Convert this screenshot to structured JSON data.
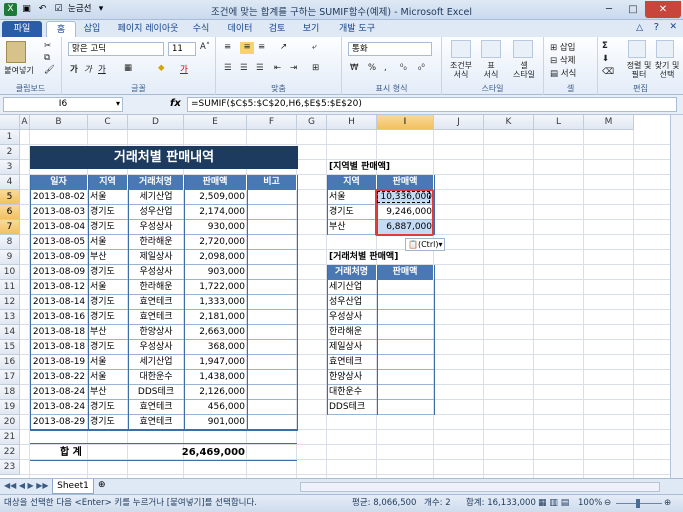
{
  "window": {
    "title": "조건에 맞는 합계를 구하는 SUMIF함수(예제) - Microsoft Excel",
    "qat_label": "눈금선"
  },
  "tabs": [
    "파일",
    "홈",
    "삽입",
    "페이지 레이아웃",
    "수식",
    "데이터",
    "검토",
    "보기",
    "개발 도구"
  ],
  "ribbon": {
    "clipboard": {
      "paste": "붙여넣기",
      "label": "클립보드"
    },
    "font": {
      "name": "맑은 고딕",
      "size": "11",
      "label": "글꼴"
    },
    "align": {
      "label": "맞춤"
    },
    "number": {
      "format": "통화",
      "label": "표시 형식"
    },
    "styles": {
      "cond": "조건부\n서식",
      "table": "표\n서식",
      "cell": "셀\n스타일",
      "label": "스타일"
    },
    "cells": {
      "insert": "삽입",
      "delete": "삭제",
      "format": "서식",
      "label": "셀"
    },
    "editing": {
      "sort": "정렬 및\n필터",
      "find": "찾기 및\n선택",
      "label": "편집"
    }
  },
  "formula_bar": {
    "name_box": "I6",
    "fx": "fx",
    "formula": "=SUMIF($C$5:$C$20,H6,$E$5:$E$20)"
  },
  "columns": [
    "A",
    "B",
    "C",
    "D",
    "E",
    "F",
    "G",
    "H",
    "I",
    "J",
    "K",
    "L",
    "M"
  ],
  "rows": [
    "1",
    "2",
    "3",
    "4",
    "5",
    "6",
    "7",
    "8",
    "9",
    "10",
    "11",
    "12",
    "13",
    "14",
    "15",
    "16",
    "17",
    "18",
    "19",
    "20",
    "21",
    "22",
    "23"
  ],
  "sheet": {
    "title": "거래처별 판매내역",
    "main_headers": [
      "일자",
      "지역",
      "거래처명",
      "판매액",
      "비고"
    ],
    "main_rows": [
      [
        "2013-08-02",
        "서울",
        "세기산업",
        "2,509,000",
        ""
      ],
      [
        "2013-08-03",
        "경기도",
        "성우산업",
        "2,174,000",
        ""
      ],
      [
        "2013-08-04",
        "경기도",
        "우성상사",
        "930,000",
        ""
      ],
      [
        "2013-08-05",
        "서울",
        "한라해운",
        "2,720,000",
        ""
      ],
      [
        "2013-08-09",
        "부산",
        "제일상사",
        "2,098,000",
        ""
      ],
      [
        "2013-08-09",
        "경기도",
        "우성상사",
        "903,000",
        ""
      ],
      [
        "2013-08-12",
        "서울",
        "한라해운",
        "1,722,000",
        ""
      ],
      [
        "2013-08-14",
        "경기도",
        "효연테크",
        "1,333,000",
        ""
      ],
      [
        "2013-08-16",
        "경기도",
        "효연테크",
        "2,181,000",
        ""
      ],
      [
        "2013-08-18",
        "부산",
        "한양상사",
        "2,663,000",
        ""
      ],
      [
        "2013-08-18",
        "경기도",
        "우성상사",
        "368,000",
        ""
      ],
      [
        "2013-08-19",
        "서울",
        "세기산업",
        "1,947,000",
        ""
      ],
      [
        "2013-08-22",
        "서울",
        "대한운수",
        "1,438,000",
        ""
      ],
      [
        "2013-08-24",
        "부산",
        "DDS테크",
        "2,126,000",
        ""
      ],
      [
        "2013-08-24",
        "경기도",
        "효연테크",
        "456,000",
        ""
      ],
      [
        "2013-08-29",
        "경기도",
        "효연테크",
        "901,000",
        ""
      ]
    ],
    "total_label": "합  계",
    "total_value": "26,469,000",
    "region_title": "[지역별 판매액]",
    "region_headers": [
      "지역",
      "판매액"
    ],
    "region_rows": [
      [
        "서울",
        "10,336,000"
      ],
      [
        "경기도",
        "9,246,000"
      ],
      [
        "부산",
        "6,887,000"
      ]
    ],
    "client_title": "[거래처별 판매액]",
    "client_headers": [
      "거래처명",
      "판매액"
    ],
    "client_rows": [
      "세기산업",
      "성우산업",
      "우성상사",
      "한라해운",
      "제일상사",
      "효연테크",
      "한양상사",
      "대한운수",
      "DDS테크"
    ],
    "paste_options": "(Ctrl)"
  },
  "sheet_tabs": [
    "Sheet1"
  ],
  "status": {
    "message": "대상을 선택한 다음 <Enter> 키를 누르거나 [붙여넣기]를 선택합니다.",
    "average": "평균: 8,066,500",
    "count": "개수: 2",
    "sum": "합계: 16,133,000",
    "zoom": "100%"
  },
  "colors": {
    "header_blue": "#4a78b5",
    "title_navy": "#1d3a5f",
    "selection_red": "#e23b3b",
    "selection_fill": "#c5daf3"
  }
}
